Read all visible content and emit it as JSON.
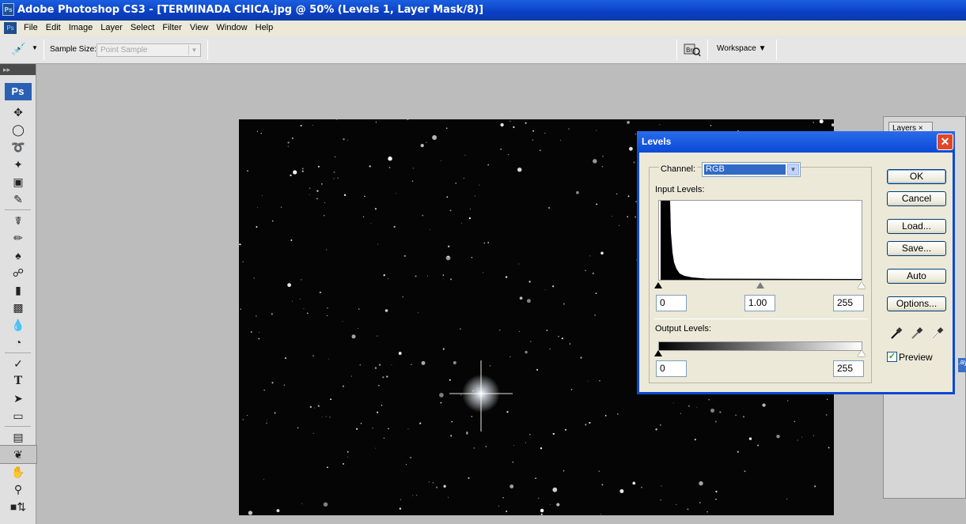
{
  "window": {
    "title": "Adobe Photoshop CS3 - [TERMINADA CHICA.jpg @ 50% (Levels 1, Layer Mask/8)]",
    "app_icon": "Ps"
  },
  "menu": [
    "File",
    "Edit",
    "Image",
    "Layer",
    "Select",
    "Filter",
    "View",
    "Window",
    "Help"
  ],
  "options": {
    "sample_size_label": "Sample Size:",
    "sample_size_value": "Point Sample",
    "workspace_label": "Workspace ▼",
    "bridge_label": "Br"
  },
  "toolbox": {
    "logo": "Ps",
    "grip": "▸▸"
  },
  "panel": {
    "tab_label": "Layers ×",
    "band_text": ".ay"
  },
  "levels": {
    "title": "Levels",
    "channel_label": "Channel:",
    "channel_value": "RGB",
    "input_levels_label": "Input Levels:",
    "input_black": "0",
    "input_gamma": "1.00",
    "input_white": "255",
    "output_levels_label": "Output Levels:",
    "output_black": "0",
    "output_white": "255",
    "buttons": {
      "ok": "OK",
      "cancel": "Cancel",
      "load": "Load...",
      "save": "Save...",
      "auto": "Auto",
      "options": "Options..."
    },
    "preview_label": "Preview",
    "preview_checked": true
  },
  "colors": {
    "title_blue": "#0a48d2",
    "selection_blue": "#316ac5",
    "canvas_black": "#050505"
  }
}
